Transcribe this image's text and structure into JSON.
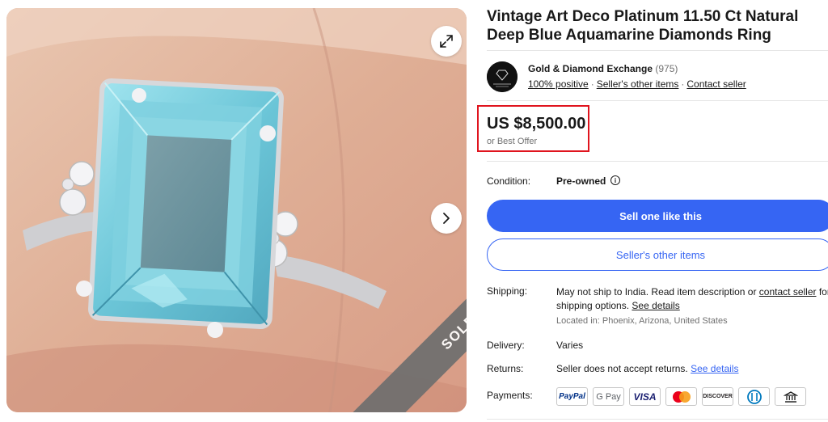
{
  "listing": {
    "title": "Vintage Art Deco Platinum 11.50 Ct Natural Deep Blue Aquamarine Diamonds Ring",
    "sold_badge": "SOLD"
  },
  "seller": {
    "name": "Gold & Diamond Exchange",
    "feedback_count": "(975)",
    "positive": "100% positive",
    "other_items_link": "Seller's other items",
    "contact_link": "Contact seller",
    "logo_text": "Gold & Diamond Exchange"
  },
  "price": {
    "amount": "US $8,500.00",
    "best_offer": "or Best Offer",
    "highlight_color": "#e0141e"
  },
  "condition": {
    "label": "Condition:",
    "value": "Pre-owned",
    "info_glyph": "i"
  },
  "buttons": {
    "primary": "Sell one like this",
    "secondary": "Seller's other items",
    "primary_color": "#3665f3"
  },
  "shipping": {
    "label": "Shipping:",
    "text_1": "May not ship to India. Read item description or ",
    "contact_link": "contact seller",
    "text_2": " for shipping options. ",
    "details_link": "See details",
    "located": "Located in: Phoenix, Arizona, United States"
  },
  "delivery": {
    "label": "Delivery:",
    "value": "Varies"
  },
  "returns": {
    "label": "Returns:",
    "value": "Seller does not accept returns. ",
    "details_link": "See details"
  },
  "payments": {
    "label": "Payments:",
    "methods": {
      "paypal": "PayPal",
      "gpay": "G Pay",
      "visa": "VISA",
      "mastercard": "mastercard-icon",
      "discover": "DISCOVER",
      "diners": "diners-icon",
      "bank": "bank-icon"
    }
  },
  "icons": {
    "expand": "expand-icon",
    "next": "chevron-right-icon"
  }
}
